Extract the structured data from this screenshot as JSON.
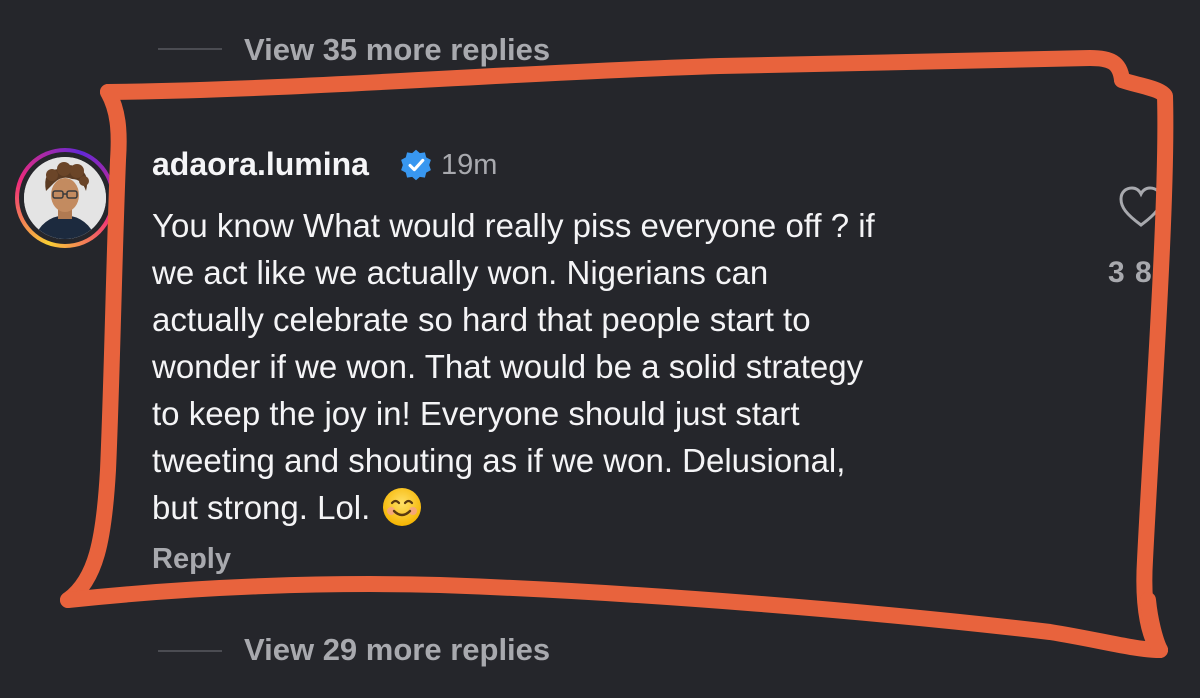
{
  "thread": {
    "view_more_top": "View 35 more replies",
    "view_more_bottom": "View 29 more replies"
  },
  "comment": {
    "username": "adaora.lumina",
    "verified": true,
    "timestamp": "19m",
    "lines": [
      "You know What would really piss everyone off ? if",
      "we act like we actually won. Nigerians can",
      "actually celebrate so hard that people start to",
      "wonder if we won. That would be a solid strategy",
      "to keep the joy in! Everyone should just start",
      "tweeting and shouting as if we won. Delusional,",
      "but strong. Lol."
    ],
    "emoji": "smiling-face-emoji",
    "reply_label": "Reply",
    "like_count": "3 8"
  },
  "icons": {
    "verified": "verified-badge-icon",
    "like": "heart-icon"
  },
  "colors": {
    "background": "#25262b",
    "text": "#f4f4f6",
    "muted": "#a8a9ae",
    "verified_blue": "#3897f0",
    "annotation_orange": "#e8633d"
  }
}
